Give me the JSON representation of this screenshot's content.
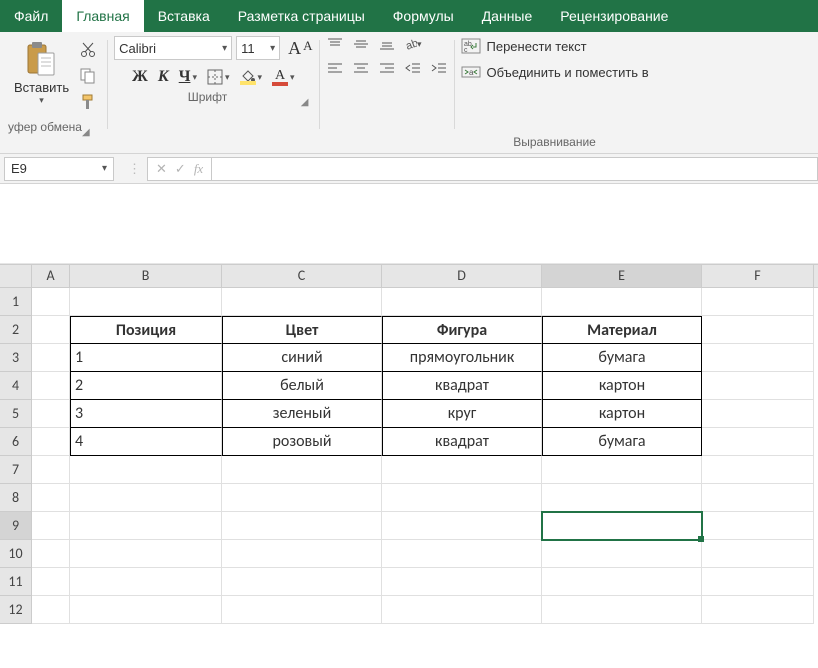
{
  "tabs": {
    "file": "Файл",
    "home": "Главная",
    "insert": "Вставка",
    "layout": "Разметка страницы",
    "formulas": "Формулы",
    "data": "Данные",
    "review": "Рецензирование"
  },
  "ribbon": {
    "clipboard": {
      "paste": "Вставить",
      "title": "уфер обмена"
    },
    "font": {
      "name": "Calibri",
      "size": "11",
      "title": "Шрифт",
      "bold": "Ж",
      "italic": "К",
      "underline": "Ч",
      "grow": "A",
      "shrink": "A",
      "fill_swatch": "#ffe36b",
      "font_swatch": "#d64b3a",
      "fontcolor_glyph": "A"
    },
    "alignment": {
      "wrap": "Перенести текст",
      "merge": "Объединить и поместить в ",
      "title": "Выравнивание"
    }
  },
  "formula_bar": {
    "name_box": "E9",
    "fx": "fx",
    "cancel": "✕",
    "enter": "✓"
  },
  "grid": {
    "cols": [
      "A",
      "B",
      "C",
      "D",
      "E",
      "F"
    ],
    "rows": [
      "1",
      "2",
      "3",
      "4",
      "5",
      "6",
      "7",
      "8",
      "9",
      "10",
      "11",
      "12"
    ],
    "selected_col": "E",
    "selected_row": "9"
  },
  "table": {
    "headers": [
      "Позиция",
      "Цвет",
      "Фигура",
      "Материал"
    ],
    "rows": [
      [
        "1",
        "синий",
        "прямоугольник",
        "бумага"
      ],
      [
        "2",
        "белый",
        "квадрат",
        "картон"
      ],
      [
        "3",
        "зеленый",
        "круг",
        "картон"
      ],
      [
        "4",
        "розовый",
        "квадрат",
        "бумага"
      ]
    ]
  },
  "chart_data": {
    "type": "table",
    "columns": [
      "Позиция",
      "Цвет",
      "Фигура",
      "Материал"
    ],
    "rows": [
      {
        "Позиция": 1,
        "Цвет": "синий",
        "Фигура": "прямоугольник",
        "Материал": "бумага"
      },
      {
        "Позиция": 2,
        "Цвет": "белый",
        "Фигура": "квадрат",
        "Материал": "картон"
      },
      {
        "Позиция": 3,
        "Цвет": "зеленый",
        "Фигура": "круг",
        "Материал": "картон"
      },
      {
        "Позиция": 4,
        "Цвет": "розовый",
        "Фигура": "квадрат",
        "Материал": "бумага"
      }
    ]
  }
}
